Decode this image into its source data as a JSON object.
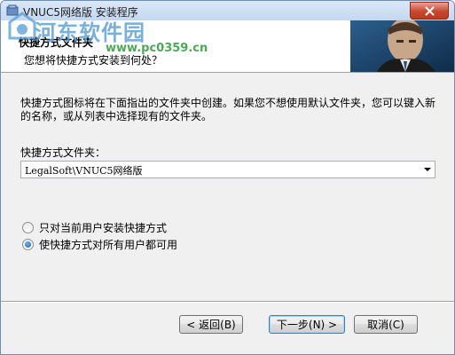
{
  "window": {
    "title": "VNUC5网络版 安装程序"
  },
  "watermark": {
    "text": "河东软件园",
    "url": "www.pc0359.cn"
  },
  "header": {
    "title": "快捷方式文件夹",
    "subtitle": "您想将快捷方式安装到何处？"
  },
  "body": {
    "description": "快捷方式图标将在下面指出的文件夹中创建。如果您不想使用默认文件夹，您可以键入新的名称，或从列表中选择现有的文件夹。",
    "folder_label": "快捷方式文件夹：",
    "folder_value": "LegalSoft\\VNUC5网络版",
    "options": [
      {
        "label": "只对当前用户安装快捷方式",
        "checked": false
      },
      {
        "label": "使快捷方式对所有用户都可用",
        "checked": true
      }
    ]
  },
  "buttons": {
    "back": "< 返回(B)",
    "next": "下一步(N) >",
    "cancel": "取消(C)"
  }
}
